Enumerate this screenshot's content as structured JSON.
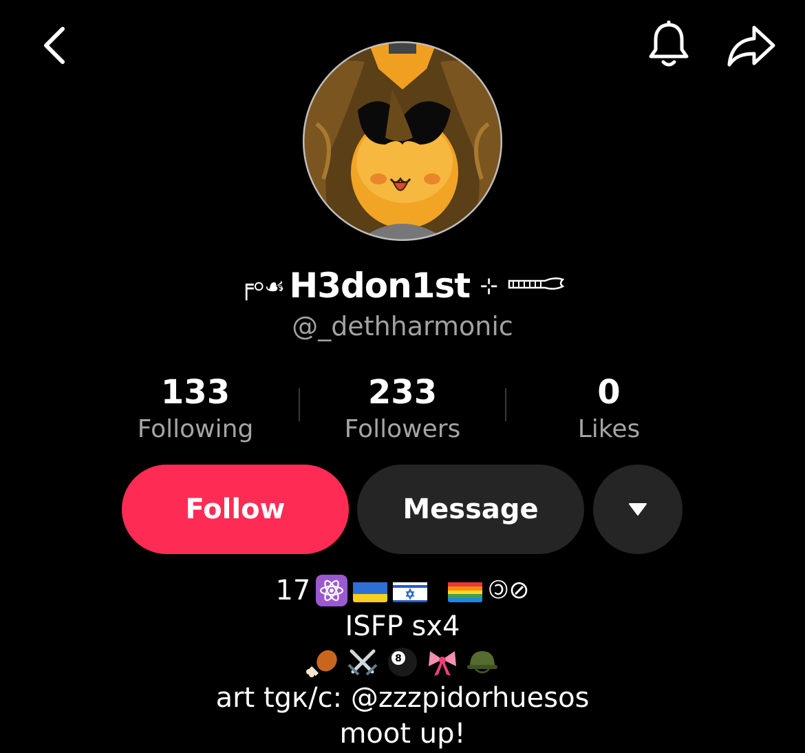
{
  "nav": {
    "back_icon": "chevron-left-icon",
    "bell_icon": "bell-icon",
    "share_icon": "share-arrow-icon"
  },
  "profile": {
    "display_name_prefix": "╒⸰☙",
    "display_name": "H3don1st",
    "display_name_suffix": "⊹",
    "username": "@_dethharmonic",
    "avatar_icon": "avatar-illustration"
  },
  "stats": [
    {
      "value": "133",
      "label": "Following"
    },
    {
      "value": "233",
      "label": "Followers"
    },
    {
      "value": "0",
      "label": "Likes"
    }
  ],
  "actions": {
    "follow_label": "Follow",
    "message_label": "Message",
    "more_icon": "caret-down-icon"
  },
  "bio": {
    "line1_text": "17",
    "line1_symbols": "🄯⊘",
    "line2": "ISFP sx4",
    "line3_icons": [
      "drumstick-icon",
      "crossed-swords-icon",
      "eight-ball-icon",
      "ribbon-icon",
      "military-helmet-icon"
    ],
    "line4": "art tgк/c: @zzzpidorhuesos",
    "line5": "moot up!"
  },
  "colors": {
    "background": "#000000",
    "follow": "#fe2c55",
    "secondary_button": "#252525",
    "muted_text": "#a2a2a2"
  }
}
